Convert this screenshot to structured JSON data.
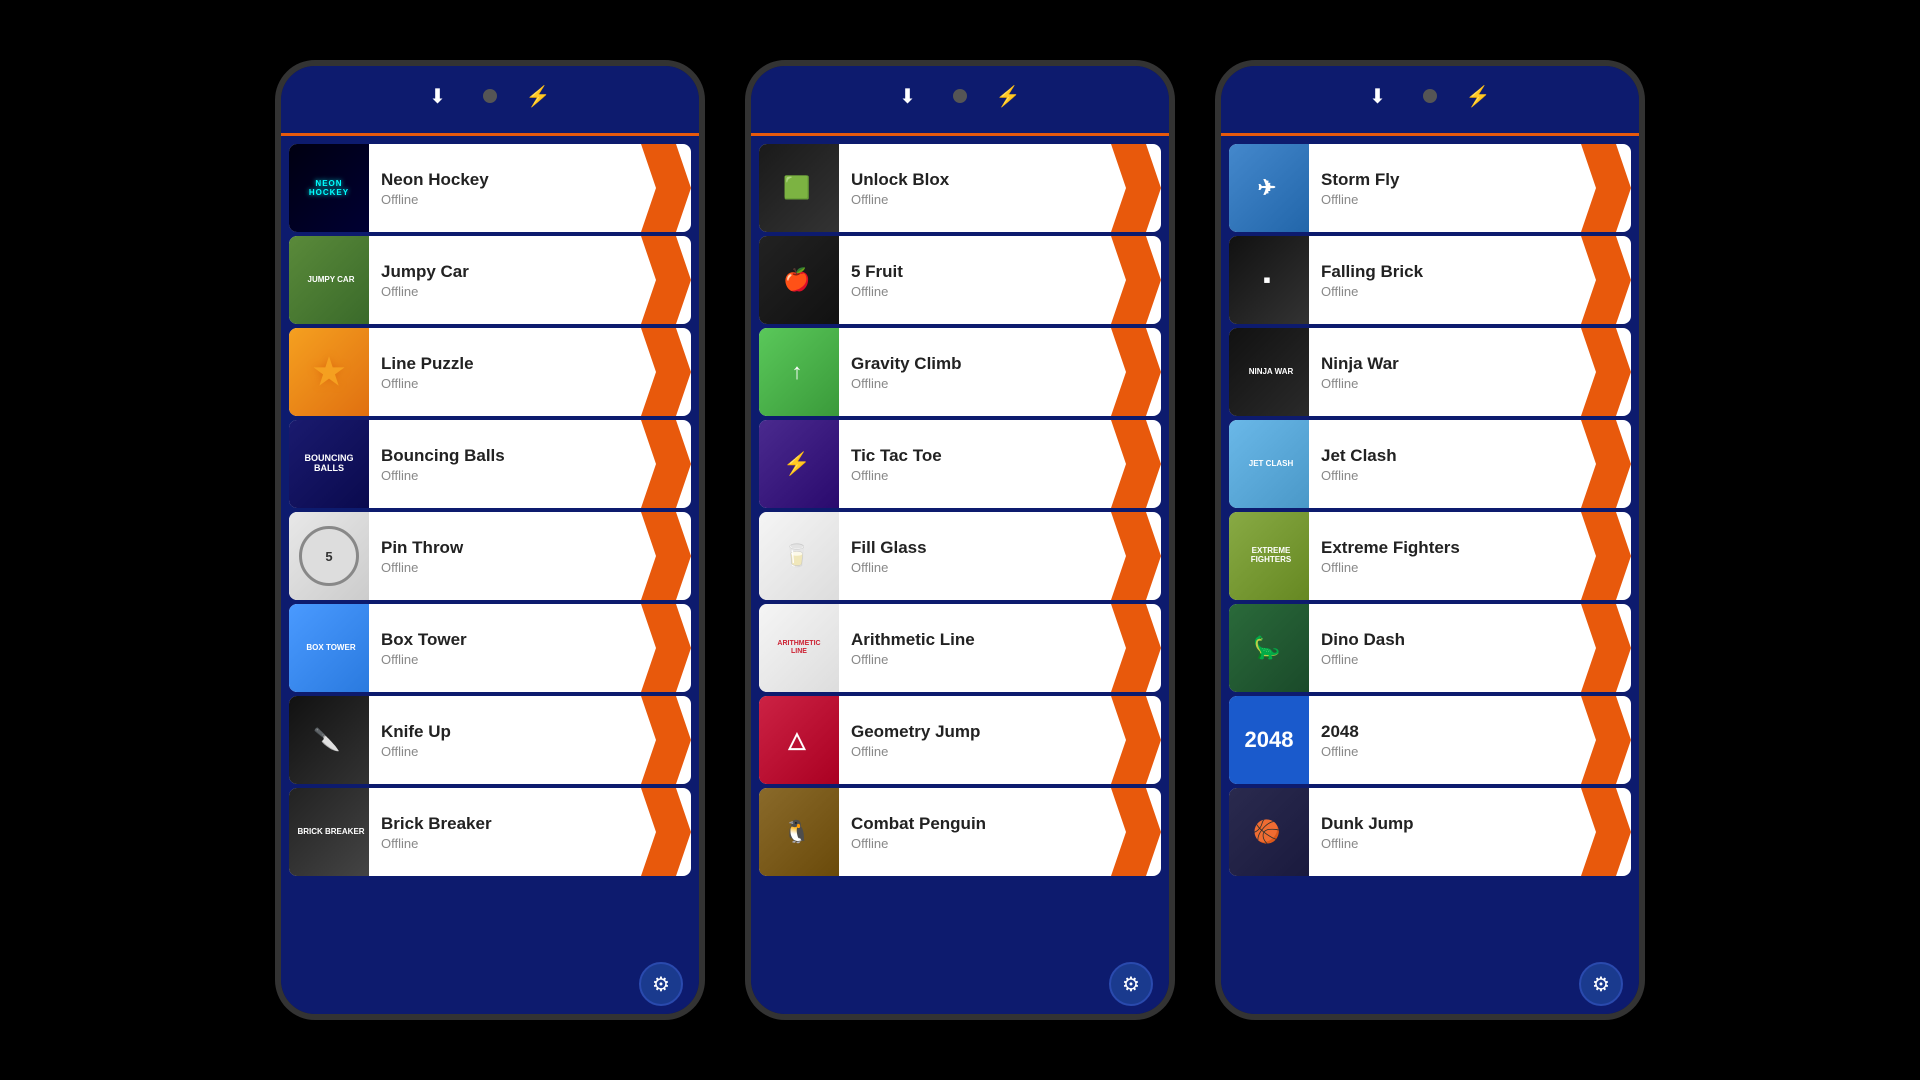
{
  "phones": [
    {
      "id": "phone1",
      "games": [
        {
          "id": "neon-hockey",
          "name": "Neon Hockey",
          "status": "Offline",
          "iconClass": "icon-neon-hockey",
          "iconContent": "NEON\nHOCKEY"
        },
        {
          "id": "jumpy-car",
          "name": "Jumpy Car",
          "status": "Offline",
          "iconClass": "icon-jumpy-car",
          "iconContent": "JUMPY\nCAR"
        },
        {
          "id": "line-puzzle",
          "name": "Line Puzzle",
          "status": "Offline",
          "iconClass": "icon-line-puzzle",
          "iconContent": "★"
        },
        {
          "id": "bouncing-balls",
          "name": "Bouncing Balls",
          "status": "Offline",
          "iconClass": "icon-bouncing-balls",
          "iconContent": "BOUNCING\nBALLS"
        },
        {
          "id": "pin-throw",
          "name": "Pin Throw",
          "status": "Offline",
          "iconClass": "icon-pin-throw",
          "iconContent": "●"
        },
        {
          "id": "box-tower",
          "name": "Box Tower",
          "status": "Offline",
          "iconClass": "icon-box-tower",
          "iconContent": "BOX\nTOWER"
        },
        {
          "id": "knife-up",
          "name": "Knife Up",
          "status": "Offline",
          "iconClass": "icon-knife-up",
          "iconContent": "🔪"
        },
        {
          "id": "brick-breaker",
          "name": "Brick Breaker",
          "status": "Offline",
          "iconClass": "icon-brick-breaker",
          "iconContent": "BRICK\nBREAKER"
        }
      ]
    },
    {
      "id": "phone2",
      "games": [
        {
          "id": "unlock-blox",
          "name": "Unlock Blox",
          "status": "Offline",
          "iconClass": "icon-unlock-blox",
          "iconContent": "🟩"
        },
        {
          "id": "5-fruit",
          "name": "5 Fruit",
          "status": "Offline",
          "iconClass": "icon-5fruit",
          "iconContent": "🍎"
        },
        {
          "id": "gravity-climb",
          "name": "Gravity Climb",
          "status": "Offline",
          "iconClass": "icon-gravity-climb",
          "iconContent": "↑"
        },
        {
          "id": "tic-tac-toe",
          "name": "Tic Tac Toe",
          "status": "Offline",
          "iconClass": "icon-tic-tac-toe",
          "iconContent": "⚡"
        },
        {
          "id": "fill-glass",
          "name": "Fill Glass",
          "status": "Offline",
          "iconClass": "icon-fill-glass",
          "iconContent": "🥛"
        },
        {
          "id": "arithmetic-line",
          "name": "Arithmetic Line",
          "status": "Offline",
          "iconClass": "icon-arithmetic",
          "iconContent": "ARITH\nMETIC\nLINE"
        },
        {
          "id": "geometry-jump",
          "name": "Geometry Jump",
          "status": "Offline",
          "iconClass": "icon-geometry-jump",
          "iconContent": "△"
        },
        {
          "id": "combat-penguin",
          "name": "Combat Penguin",
          "status": "Offline",
          "iconClass": "icon-combat-penguin",
          "iconContent": "🐧"
        }
      ]
    },
    {
      "id": "phone3",
      "games": [
        {
          "id": "storm-fly",
          "name": "Storm Fly",
          "status": "Offline",
          "iconClass": "icon-storm-fly",
          "iconContent": "✈"
        },
        {
          "id": "falling-brick",
          "name": "Falling Brick",
          "status": "Offline",
          "iconClass": "icon-falling-brick",
          "iconContent": "▪"
        },
        {
          "id": "ninja-war",
          "name": "Ninja War",
          "status": "Offline",
          "iconClass": "icon-ninja-war",
          "iconContent": "NINJA\nWAR"
        },
        {
          "id": "jet-clash",
          "name": "Jet Clash",
          "status": "Offline",
          "iconClass": "icon-jet-clash",
          "iconContent": "JET\nCLASH"
        },
        {
          "id": "extreme-fighters",
          "name": "Extreme Fighters",
          "status": "Offline",
          "iconClass": "icon-extreme-fighters",
          "iconContent": "EXTREME\nFIGHTERS"
        },
        {
          "id": "dino-dash",
          "name": "Dino Dash",
          "status": "Offline",
          "iconClass": "icon-dino-dash",
          "iconContent": "🦕"
        },
        {
          "id": "2048",
          "name": "2048",
          "status": "Offline",
          "iconClass": "icon-2048",
          "iconContent": "2048"
        },
        {
          "id": "dunk-jump",
          "name": "Dunk Jump",
          "status": "Offline",
          "iconClass": "icon-dunk-jump",
          "iconContent": "🏀"
        }
      ]
    }
  ],
  "ui": {
    "download_icon": "⬇",
    "bolt_icon": "⚡",
    "settings_icon": "⚙",
    "offline_label": "Offline"
  }
}
